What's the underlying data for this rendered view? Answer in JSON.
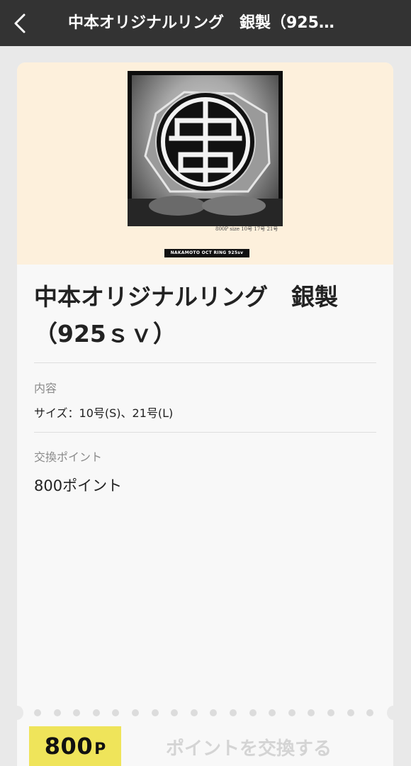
{
  "header": {
    "title": "中本オリジナルリング　銀製（925…"
  },
  "hero": {
    "image_alt": "NAKAMOTO OCT RING 925sv",
    "size_note": "800P size 10号 17号 21号",
    "caption": "NAKAMOTO OCT RING 925sv"
  },
  "product": {
    "title": "中本オリジナルリング　銀製（925ｓｖ）"
  },
  "details": {
    "content_label": "内容",
    "content_value": "サイズ：10号(S)、21号(L)",
    "points_label": "交換ポイント",
    "points_value": "800ポイント"
  },
  "footer": {
    "points_amount": "800",
    "points_unit": "P",
    "exchange_label": "ポイントを交換する"
  },
  "colors": {
    "header_bg": "#333333",
    "hero_bg": "#fdf0dc",
    "badge_bg": "#efe45a",
    "disabled_text": "#d4d4d4"
  }
}
